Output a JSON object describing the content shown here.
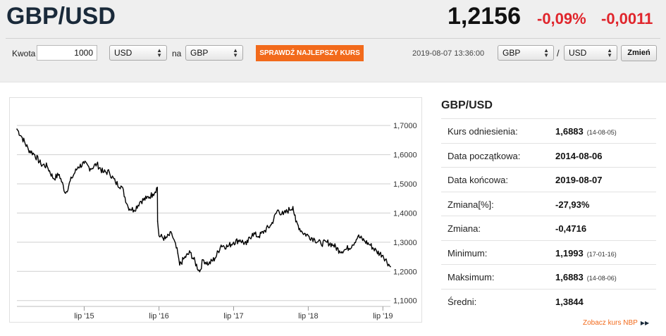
{
  "header": {
    "pair": "GBP/USD",
    "price": "1,2156",
    "change_pct": "-0,09%",
    "change_abs": "-0,0011"
  },
  "converter": {
    "amount_label": "Kwota",
    "amount_value": "1000",
    "from_currency": "USD",
    "na_label": "na",
    "to_currency": "GBP",
    "best_rate_button": "SPRAWDŹ NAJLEPSZY KURS"
  },
  "pair_switch": {
    "timestamp": "2019-08-07 13:36:00",
    "base": "GBP",
    "slash": "/",
    "quote": "USD",
    "change_button": "Zmień"
  },
  "stats": {
    "title": "GBP/USD",
    "rows": [
      {
        "label": "Kurs odniesienia:",
        "value": "1,6883",
        "date": "(14-08-05)"
      },
      {
        "label": "Data początkowa:",
        "value": "2014-08-06",
        "date": ""
      },
      {
        "label": "Data końcowa:",
        "value": "2019-08-07",
        "date": ""
      },
      {
        "label": "Zmiana[%]:",
        "value": "-27,93%",
        "date": ""
      },
      {
        "label": "Zmiana:",
        "value": "-0,4716",
        "date": ""
      },
      {
        "label": "Minimum:",
        "value": "1,1993",
        "date": "(17-01-16)"
      },
      {
        "label": "Maksimum:",
        "value": "1,6883",
        "date": "(14-08-06)"
      },
      {
        "label": "Średni:",
        "value": "1,3844",
        "date": ""
      }
    ],
    "nbp_link": "Zobacz kurs NBP",
    "nbp_link_icon": "double-chevron-right"
  },
  "chart_data": {
    "type": "line",
    "series": [
      {
        "values": [
          [
            "2014-08-06",
            1.688
          ],
          [
            "2014-09-01",
            1.658
          ],
          [
            "2014-10-01",
            1.618
          ],
          [
            "2014-11-01",
            1.6
          ],
          [
            "2014-12-01",
            1.568
          ],
          [
            "2015-01-01",
            1.56
          ],
          [
            "2015-02-01",
            1.518
          ],
          [
            "2015-03-01",
            1.532
          ],
          [
            "2015-04-01",
            1.468
          ],
          [
            "2015-05-01",
            1.52
          ],
          [
            "2015-06-01",
            1.558
          ],
          [
            "2015-07-01",
            1.57
          ],
          [
            "2015-08-01",
            1.552
          ],
          [
            "2015-09-01",
            1.568
          ],
          [
            "2015-10-01",
            1.54
          ],
          [
            "2015-11-01",
            1.54
          ],
          [
            "2015-12-01",
            1.505
          ],
          [
            "2016-01-01",
            1.49
          ],
          [
            "2016-02-01",
            1.42
          ],
          [
            "2016-03-01",
            1.41
          ],
          [
            "2016-04-01",
            1.44
          ],
          [
            "2016-05-01",
            1.45
          ],
          [
            "2016-06-01",
            1.465
          ],
          [
            "2016-06-23",
            1.488
          ],
          [
            "2016-06-24",
            1.372
          ],
          [
            "2016-07-01",
            1.322
          ],
          [
            "2016-08-01",
            1.312
          ],
          [
            "2016-09-01",
            1.33
          ],
          [
            "2016-10-01",
            1.262
          ],
          [
            "2016-10-10",
            1.222
          ],
          [
            "2016-11-01",
            1.245
          ],
          [
            "2016-12-01",
            1.265
          ],
          [
            "2017-01-16",
            1.199
          ],
          [
            "2017-02-01",
            1.24
          ],
          [
            "2017-03-01",
            1.225
          ],
          [
            "2017-04-01",
            1.245
          ],
          [
            "2017-05-01",
            1.29
          ],
          [
            "2017-06-01",
            1.285
          ],
          [
            "2017-07-01",
            1.3
          ],
          [
            "2017-08-01",
            1.308
          ],
          [
            "2017-09-01",
            1.292
          ],
          [
            "2017-10-01",
            1.33
          ],
          [
            "2017-11-01",
            1.32
          ],
          [
            "2017-12-01",
            1.34
          ],
          [
            "2018-01-01",
            1.36
          ],
          [
            "2018-02-01",
            1.41
          ],
          [
            "2018-03-01",
            1.395
          ],
          [
            "2018-04-17",
            1.422
          ],
          [
            "2018-05-01",
            1.37
          ],
          [
            "2018-06-01",
            1.335
          ],
          [
            "2018-07-01",
            1.322
          ],
          [
            "2018-08-01",
            1.31
          ],
          [
            "2018-09-01",
            1.295
          ],
          [
            "2018-10-01",
            1.3
          ],
          [
            "2018-11-01",
            1.29
          ],
          [
            "2018-12-01",
            1.27
          ],
          [
            "2019-01-01",
            1.275
          ],
          [
            "2019-02-01",
            1.29
          ],
          [
            "2019-03-01",
            1.32
          ],
          [
            "2019-04-01",
            1.305
          ],
          [
            "2019-05-01",
            1.29
          ],
          [
            "2019-06-01",
            1.268
          ],
          [
            "2019-07-01",
            1.255
          ],
          [
            "2019-08-07",
            1.216
          ]
        ]
      }
    ],
    "x_ticks": [
      "lip '15",
      "lip '16",
      "lip '17",
      "lip '18",
      "lip '19"
    ],
    "y_ticks": [
      "1,1000",
      "1,2000",
      "1,3000",
      "1,4000",
      "1,5000",
      "1,6000",
      "1,7000"
    ],
    "xlim": [
      "2014-08-06",
      "2019-08-07"
    ],
    "ylim": [
      1.08,
      1.78
    ],
    "grid": "horizontal",
    "y_axis_position": "right",
    "line_color": "#000000"
  }
}
